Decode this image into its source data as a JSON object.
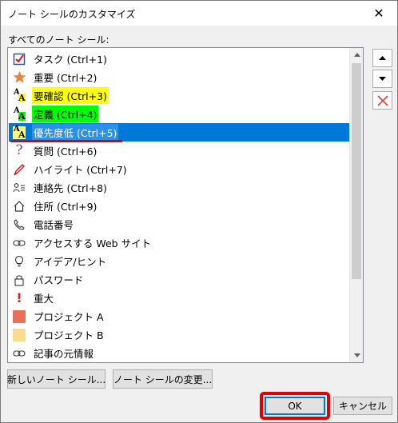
{
  "window": {
    "title": "ノート シールのカスタマイズ",
    "close_glyph": "✕"
  },
  "list": {
    "label": "すべてのノート シール:",
    "items": [
      {
        "label": "タスク (Ctrl+1)",
        "icon": "checkbox-icon"
      },
      {
        "label": "重要 (Ctrl+2)",
        "icon": "star-icon"
      },
      {
        "label": "要確認 (Ctrl+3)",
        "icon": "highlight-yellow-icon"
      },
      {
        "label": "定義 (Ctrl+4)",
        "icon": "highlight-green-icon"
      },
      {
        "label": "優先度低 (Ctrl+5)",
        "icon": "highlight-icon"
      },
      {
        "label": "質問 (Ctrl+6)",
        "icon": "question-icon"
      },
      {
        "label": "ハイライト (Ctrl+7)",
        "icon": "pen-icon"
      },
      {
        "label": "連絡先 (Ctrl+8)",
        "icon": "contact-icon"
      },
      {
        "label": "住所 (Ctrl+9)",
        "icon": "home-icon"
      },
      {
        "label": "電話番号",
        "icon": "phone-icon"
      },
      {
        "label": "アクセスする Web サイト",
        "icon": "link-icon"
      },
      {
        "label": "アイデア/ヒント",
        "icon": "lightbulb-icon"
      },
      {
        "label": "パスワード",
        "icon": "lock-icon"
      },
      {
        "label": "重大",
        "icon": "exclamation-icon"
      },
      {
        "label": "プロジェクト A",
        "icon": "red-square-icon"
      },
      {
        "label": "プロジェクト B",
        "icon": "yellow-square-icon"
      },
      {
        "label": "記事の元情報",
        "icon": "link-icon"
      }
    ],
    "selected_index": 4
  },
  "buttons": {
    "new_tag": "新しいノート シール...",
    "modify_tag": "ノート シールの変更...",
    "ok": "OK",
    "cancel": "キャンセル"
  },
  "colors": {
    "selection": "#0078d7",
    "highlight_yellow": "#ffff00",
    "highlight_green": "#00ff00",
    "annotation_red": "#e00000",
    "star_orange": "#e8833a",
    "project_a": "#e8715c",
    "project_b": "#fbdb8f"
  }
}
